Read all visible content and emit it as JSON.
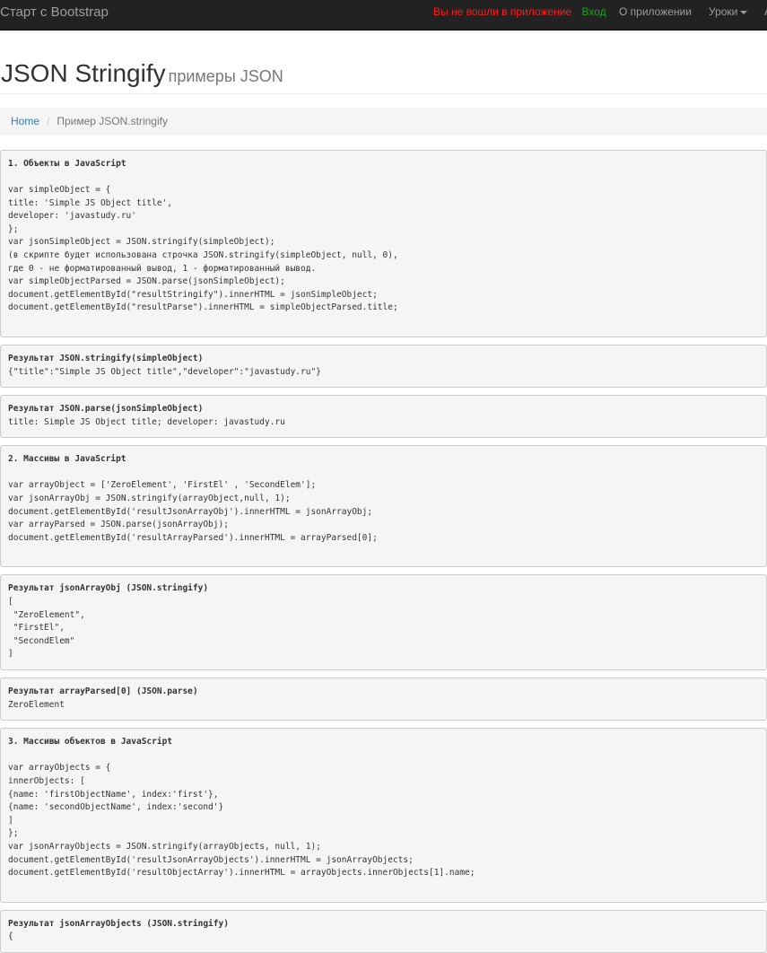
{
  "navbar": {
    "brand": "Старт с Bootstrap",
    "not_logged_in": "Вы не вошли в приложение",
    "login": "Вход",
    "about": "О приложении",
    "lessons": "Уроки",
    "overflow": "А"
  },
  "header": {
    "title": "JSON Stringify",
    "subtitle": "примеры JSON"
  },
  "breadcrumb": {
    "home": "Home",
    "current": "Пример JSON.stringify"
  },
  "sections": {
    "s1": {
      "title": "1. Объекты в JavaScript",
      "code": "\nvar simpleObject = {\ntitle: 'Simple JS Object title',\ndeveloper: 'javastudy.ru'\n};\nvar jsonSimpleObject = JSON.stringify(simpleObject);\n(в скрипте будет использована строчка JSON.stringify(simpleObject, null, 0),\nгде 0 - не форматированный вывод, 1 - форматированный вывод.\nvar simpleObjectParsed = JSON.parse(jsonSimpleObject);\ndocument.getElementById(\"resultStringify\").innerHTML = jsonSimpleObject;\ndocument.getElementById(\"resultParse\").innerHTML = simpleObjectParsed.title;"
    },
    "r1a": {
      "title": "Результат JSON.stringify(simpleObject)",
      "code": "{\"title\":\"Simple JS Object title\",\"developer\":\"javastudy.ru\"}"
    },
    "r1b": {
      "title": "Результат JSON.parse(jsonSimpleObject)",
      "code": "title: Simple JS Object title; developer: javastudy.ru"
    },
    "s2": {
      "title": "2. Массивы в JavaScript",
      "code": "\nvar arrayObject = ['ZeroElement', 'FirstEl' , 'SecondElem'];\nvar jsonArrayObj = JSON.stringify(arrayObject,null, 1);\ndocument.getElementById('resultJsonArrayObj').innerHTML = jsonArrayObj;\nvar arrayParsed = JSON.parse(jsonArrayObj);\ndocument.getElementById('resultArrayParsed').innerHTML = arrayParsed[0];"
    },
    "r2a": {
      "title": "Результат jsonArrayObj (JSON.stringify)",
      "code": "[\n \"ZeroElement\",\n \"FirstEl\",\n \"SecondElem\"\n]"
    },
    "r2b": {
      "title": "Результат arrayParsed[0] (JSON.parse)",
      "code": "ZeroElement"
    },
    "s3": {
      "title": "3. Массивы объектов в JavaScript",
      "code": "\nvar arrayObjects = {\ninnerObjects: [\n{name: 'firstObjectName', index:'first'},\n{name: 'secondObjectName', index:'second'}\n]\n};\nvar jsonArrayObjects = JSON.stringify(arrayObjects, null, 1);\ndocument.getElementById('resultJsonArrayObjects').innerHTML = jsonArrayObjects;\ndocument.getElementById('resultObjectArray').innerHTML = arrayObjects.innerObjects[1].name;"
    },
    "r3a": {
      "title": "Результат jsonArrayObjects (JSON.stringify)",
      "code": "{"
    }
  },
  "colors": {
    "navbar_bg": "#222222",
    "not_logged_in": "#ff1c1c",
    "login": "#1fa01f",
    "link": "#337ab7"
  }
}
